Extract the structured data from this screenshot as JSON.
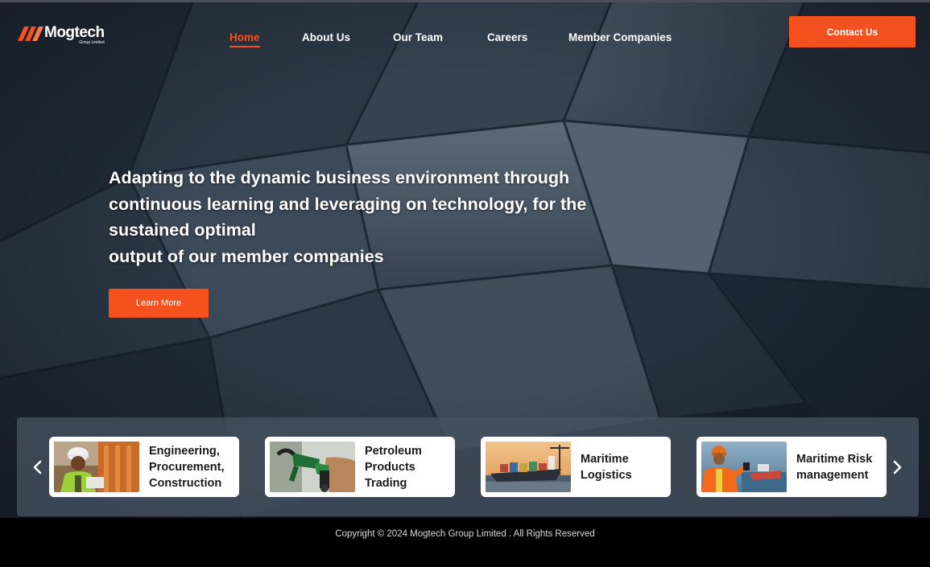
{
  "header": {
    "logo": {
      "name": "Mogtech",
      "subtitle": "Group Limited"
    },
    "nav": [
      {
        "label": "Home",
        "active": true
      },
      {
        "label": "About Us",
        "active": false
      },
      {
        "label": "Our Team",
        "active": false
      },
      {
        "label": "Careers",
        "active": false
      },
      {
        "label": "Member Companies",
        "active": false
      }
    ],
    "contact_label": "Contact Us"
  },
  "hero": {
    "headline_lines": [
      "Adapting to the dynamic business environment through",
      "continuous learning and leveraging on technology, for the",
      "sustained optimal",
      "output of our member companies"
    ],
    "cta_label": "Learn More"
  },
  "carousel": {
    "prev_icon": "chevron-left-icon",
    "next_icon": "chevron-right-icon",
    "cards": [
      {
        "label_lines": [
          "Engineering,",
          "Procurement,",
          "Construction"
        ],
        "image": "construction-worker-photo"
      },
      {
        "label_lines": [
          "Petroleum",
          "Products",
          "Trading"
        ],
        "image": "fuel-nozzle-photo"
      },
      {
        "label_lines": [
          "Maritime",
          "Logistics"
        ],
        "image": "cargo-ship-photo"
      },
      {
        "label_lines": [
          "Maritime Risk",
          "management"
        ],
        "image": "maritime-worker-photo"
      }
    ]
  },
  "footer": {
    "copyright": "Copyright © 2024 Mogtech Group Limited . All Rights Reserved"
  },
  "colors": {
    "accent": "#f4511e",
    "hero_dark": "#1c2634",
    "footer_bg": "#000000",
    "card_bg": "#ffffff"
  }
}
